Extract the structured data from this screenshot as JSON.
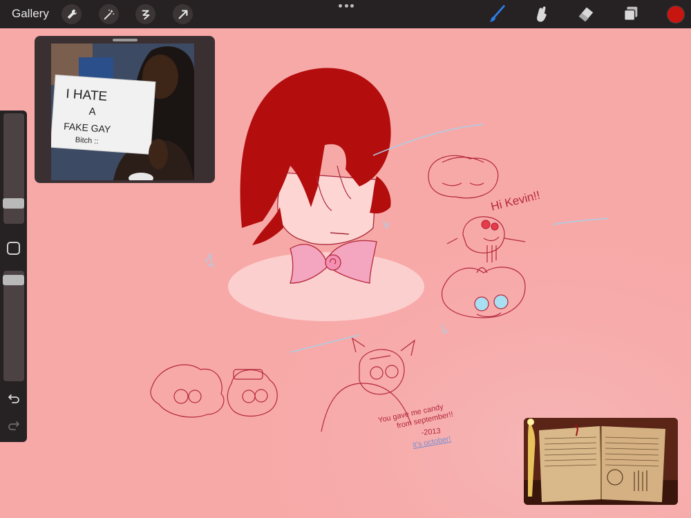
{
  "toolbar": {
    "gallery_label": "Gallery",
    "tools": [
      {
        "name": "wrench-icon",
        "label": "Actions"
      },
      {
        "name": "magic-wand-icon",
        "label": "Adjustments"
      },
      {
        "name": "selection-icon",
        "label": "Selection"
      },
      {
        "name": "transform-arrow-icon",
        "label": "Transform"
      }
    ],
    "right_tools": [
      {
        "name": "brush-icon",
        "active": true
      },
      {
        "name": "smudge-icon",
        "active": false
      },
      {
        "name": "eraser-icon",
        "active": false
      },
      {
        "name": "layers-icon",
        "active": false
      }
    ],
    "current_color": "#c8150f"
  },
  "sidebar": {
    "size_slider_value": 0.17,
    "opacity_slider_value": 0.97
  },
  "reference_photo": {
    "sign_text_line1": "I HATE",
    "sign_text_line2": "A",
    "sign_text_line3": "FAKE GAY",
    "sign_text_line4": "Bitch ::"
  },
  "canvas": {
    "background_color": "#f7a9a8",
    "annotations": {
      "hi_kevin": "Hi Kevin!!",
      "note_line1": "You gave me candy",
      "note_line2": "from september!!",
      "note_line3": "-2013",
      "note_line4": "it's october!"
    }
  },
  "colors": {
    "toolbar_bg": "#262122",
    "accent_blue": "#2b7de3",
    "hair_red": "#b30d0d",
    "sketch_red": "#b3273a",
    "bow_pink": "#f4a6c0"
  }
}
